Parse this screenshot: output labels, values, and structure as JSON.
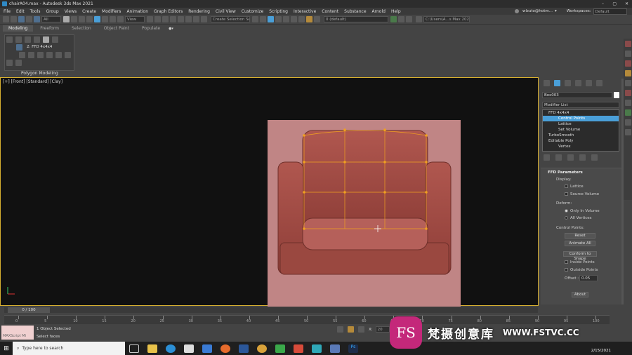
{
  "title_bar": {
    "title": "chairA04.max - Autodesk 3ds Max 2021"
  },
  "menu": [
    "File",
    "Edit",
    "Tools",
    "Group",
    "Views",
    "Create",
    "Modifiers",
    "Animation",
    "Graph Editors",
    "Rendering",
    "Civil View",
    "Customize",
    "Scripting",
    "Interactive",
    "Content",
    "Substance",
    "Arnold",
    "Help"
  ],
  "user": {
    "name": "wlzuto@hotm...",
    "workspaces_label": "Workspaces:",
    "workspace": "Default"
  },
  "toolbar": {
    "filter": "All",
    "ref_coord": "View",
    "selection_set": "Create Selection Se",
    "layer": "0 (default)",
    "path": "C:\\Users\\A...s Max 2021"
  },
  "ribbon": {
    "tabs": [
      "Modeling",
      "Freeform",
      "Selection",
      "Object Paint",
      "Populate"
    ],
    "modifier_label": "2: FFD 4x4x4",
    "panel_label": "Polygon Modeling"
  },
  "viewport": {
    "label": "[+] [Front] [Standard] [Clay]"
  },
  "command_panel": {
    "object_name": "Box003",
    "modifier_list": "Modifier List",
    "stack": [
      {
        "label": "FFD 4x4x4"
      },
      {
        "label": "Control Points",
        "selected": true
      },
      {
        "label": "Lattice"
      },
      {
        "label": "Set Volume"
      },
      {
        "label": "TurboSmooth"
      },
      {
        "label": "Editable Poly"
      },
      {
        "label": "Vertex"
      }
    ],
    "rollout_title": "FFD Parameters",
    "display_label": "Display:",
    "lattice": "Lattice",
    "source_volume": "Source Volume",
    "deform_label": "Deform:",
    "only_in_volume": "Only In Volume",
    "all_vertices": "All Vertices",
    "control_points_label": "Control Points:",
    "reset": "Reset",
    "animate_all": "Animate All",
    "conform": "Conform to Shape",
    "inside_points": "Inside Points",
    "outside_points": "Outside Points",
    "offset_label": "Offset :",
    "offset_value": "0.05",
    "about": "About"
  },
  "timeline": {
    "frame": "0 / 100",
    "ticks": [
      "0",
      "5",
      "10",
      "15",
      "20",
      "25",
      "30",
      "35",
      "40",
      "45",
      "50",
      "55",
      "60",
      "65",
      "70",
      "75",
      "80",
      "85",
      "90",
      "95",
      "100"
    ]
  },
  "status": {
    "maxscript": "MAXScript Mi",
    "objects": "1 Object Selected",
    "prompt": "Select faces",
    "x_label": "X:",
    "x_value": "20"
  },
  "taskbar": {
    "search": "Type here to search",
    "date": "2/15/2021"
  },
  "watermark": {
    "logo": "FS",
    "cn": "梵摄创意库",
    "url": "WWW.FSTVC.CC"
  },
  "colors": {
    "accent": "#4a9fd8",
    "viewport_bg": "#111111",
    "clay": "#c08585",
    "chair": "#a8524a",
    "lattice": "#f0a020"
  }
}
